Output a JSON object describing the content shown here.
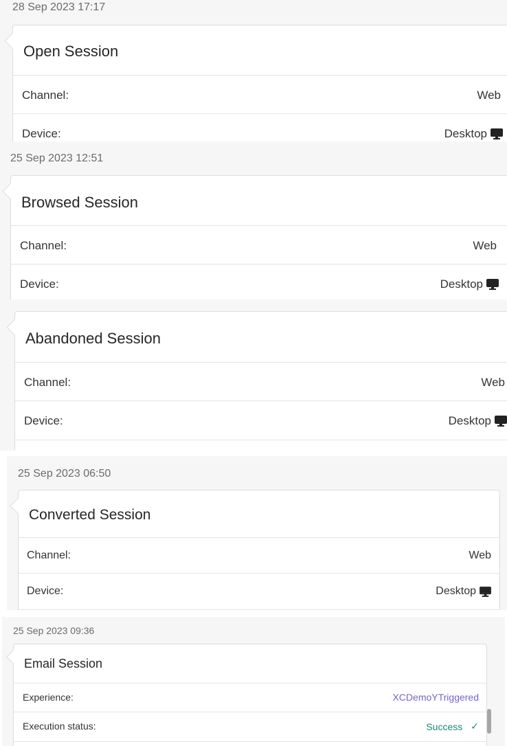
{
  "sessions": [
    {
      "timestamp": "28 Sep 2023 17:17",
      "title": "Open Session",
      "rows": [
        {
          "label": "Channel:",
          "value": "Web"
        },
        {
          "label": "Device:",
          "value": "Desktop",
          "icon": "desktop-icon"
        }
      ]
    },
    {
      "timestamp": "25 Sep 2023 12:51",
      "title": "Browsed Session",
      "rows": [
        {
          "label": "Channel:",
          "value": "Web"
        },
        {
          "label": "Device:",
          "value": "Desktop",
          "icon": "desktop-icon"
        }
      ]
    },
    {
      "title": "Abandoned Session",
      "rows": [
        {
          "label": "Channel:",
          "value": "Web"
        },
        {
          "label": "Device:",
          "value": "Desktop",
          "icon": "desktop-icon"
        }
      ]
    },
    {
      "timestamp": "25 Sep 2023 06:50",
      "title": "Converted Session",
      "rows": [
        {
          "label": "Channel:",
          "value": "Web"
        },
        {
          "label": "Device:",
          "value": "Desktop",
          "icon": "desktop-icon"
        }
      ]
    },
    {
      "timestamp": "25 Sep 2023 09:36",
      "title": "Email Session",
      "rows": [
        {
          "label": "Experience:",
          "value": "XCDemoYTriggered",
          "value_color": "#7b63c8"
        },
        {
          "label": "Execution status:",
          "value": "Success",
          "value_color": "#1a8a73",
          "icon": "checkmark-icon"
        }
      ]
    }
  ]
}
